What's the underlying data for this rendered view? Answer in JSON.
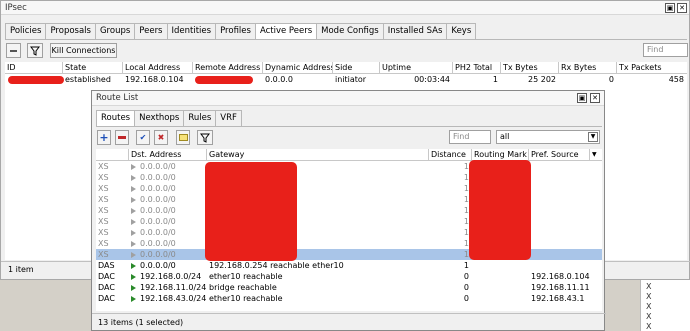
{
  "ipsec": {
    "title": "IPsec",
    "tabs": [
      "Policies",
      "Proposals",
      "Groups",
      "Peers",
      "Identities",
      "Profiles",
      "Active Peers",
      "Mode Configs",
      "Installed SAs",
      "Keys"
    ],
    "active_tab": "Active Peers",
    "kill_button": "Kill Connections",
    "find_placeholder": "Find",
    "columns": [
      "ID",
      "State",
      "Local Address",
      "Remote Address",
      "Dynamic Address",
      "Side",
      "Uptime",
      "PH2 Total",
      "Tx Bytes",
      "Rx Bytes",
      "Tx Packets"
    ],
    "row": {
      "id": "",
      "state": "established",
      "local": "192.168.0.104",
      "remote": "",
      "dynamic": "0.0.0.0",
      "side": "initiator",
      "uptime": "00:03:44",
      "ph2": "1",
      "tx_bytes": "25 202",
      "rx_bytes": "0",
      "tx_packets": "458"
    },
    "status": "1 item"
  },
  "route_list": {
    "title": "Route List",
    "tabs": [
      "Routes",
      "Nexthops",
      "Rules",
      "VRF"
    ],
    "active_tab": "Routes",
    "find_placeholder": "Find",
    "filter_value": "all",
    "columns": [
      "",
      "Dst. Address",
      "Gateway",
      "Distance",
      "Routing Mark",
      "Pref. Source"
    ],
    "rows": [
      {
        "flag": "XS",
        "dst": "0.0.0.0/0",
        "gateway": "",
        "distance": "1",
        "mark": "",
        "pref": "",
        "disabled": true
      },
      {
        "flag": "XS",
        "dst": "0.0.0.0/0",
        "gateway": "",
        "distance": "1",
        "mark": "",
        "pref": "",
        "disabled": true
      },
      {
        "flag": "XS",
        "dst": "0.0.0.0/0",
        "gateway": "",
        "distance": "1",
        "mark": "",
        "pref": "",
        "disabled": true
      },
      {
        "flag": "XS",
        "dst": "0.0.0.0/0",
        "gateway": "",
        "distance": "1",
        "mark": "",
        "pref": "",
        "disabled": true
      },
      {
        "flag": "XS",
        "dst": "0.0.0.0/0",
        "gateway": "",
        "distance": "1",
        "mark": "",
        "pref": "",
        "disabled": true
      },
      {
        "flag": "XS",
        "dst": "0.0.0.0/0",
        "gateway": "",
        "distance": "1",
        "mark": "",
        "pref": "",
        "disabled": true
      },
      {
        "flag": "XS",
        "dst": "0.0.0.0/0",
        "gateway": "",
        "distance": "1",
        "mark": "",
        "pref": "",
        "disabled": true
      },
      {
        "flag": "XS",
        "dst": "0.0.0.0/0",
        "gateway": "",
        "distance": "1",
        "mark": "",
        "pref": "",
        "disabled": true
      },
      {
        "flag": "XS",
        "dst": "0.0.0.0/0",
        "gateway": "",
        "distance": "1",
        "mark": "",
        "pref": "",
        "disabled": true,
        "selected": true
      },
      {
        "flag": "DAS",
        "dst": "0.0.0.0/0",
        "gateway": "192.168.0.254 reachable ether10",
        "distance": "1",
        "mark": "",
        "pref": ""
      },
      {
        "flag": "DAC",
        "dst": "192.168.0.0/24",
        "gateway": "ether10 reachable",
        "distance": "0",
        "mark": "",
        "pref": "192.168.0.104"
      },
      {
        "flag": "DAC",
        "dst": "192.168.11.0/24",
        "gateway": "bridge reachable",
        "distance": "0",
        "mark": "",
        "pref": "192.168.11.111"
      },
      {
        "flag": "DAC",
        "dst": "192.168.43.0/24",
        "gateway": "ether10 reachable",
        "distance": "0",
        "mark": "",
        "pref": "192.168.43.1"
      }
    ],
    "status": "13 items (1 selected)"
  },
  "side_list": [
    "X",
    "X",
    "X",
    "X",
    "X"
  ]
}
